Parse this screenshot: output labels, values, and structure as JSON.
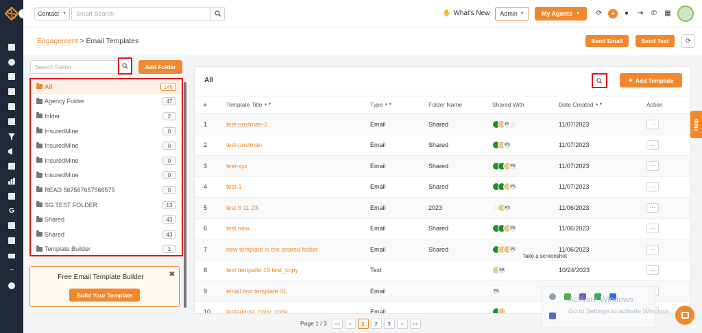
{
  "topbar": {
    "contact_select": "Contact",
    "search_placeholder": "Smart Search",
    "whats_new": "What's New",
    "role": "Admin",
    "my_agents": "My Agents"
  },
  "breadcrumb": {
    "root": "Engagement",
    "separator": ">",
    "current": "Email Templates"
  },
  "actions": {
    "send_email": "Send Email",
    "send_text": "Send Text"
  },
  "folders": {
    "search_placeholder": "Search Folder",
    "add_folder": "Add Folder",
    "items": [
      {
        "name": "All",
        "count": "146",
        "active": true
      },
      {
        "name": "Agency Folder",
        "count": "47"
      },
      {
        "name": "folder",
        "count": "2"
      },
      {
        "name": "InsuredMine",
        "count": "0"
      },
      {
        "name": "InsuredMine",
        "count": "0"
      },
      {
        "name": "InsuredMine",
        "count": "0"
      },
      {
        "name": "InsuredMine",
        "count": "0"
      },
      {
        "name": "READ 567567657566575",
        "count": "0"
      },
      {
        "name": "SG TEST FOLDER",
        "count": "13"
      },
      {
        "name": "Shared",
        "count": "43"
      },
      {
        "name": "Shared",
        "count": "43"
      },
      {
        "name": "Template Builder",
        "count": "1"
      }
    ]
  },
  "promo": {
    "title": "Free Email Template Builder",
    "button": "Build Your Template"
  },
  "templates": {
    "panel_title": "All",
    "add_button": "Add Template",
    "columns": {
      "num": "#",
      "title": "Template Title",
      "type": "Type",
      "folder": "Folder Name",
      "shared": "Shared With",
      "date": "Date Created",
      "action": "Action"
    },
    "rows": [
      {
        "num": "1",
        "title": "test-postman-2",
        "type": "Email",
        "folder": "Shared",
        "shared": [
          "green",
          "face",
          "ps",
          "person"
        ],
        "date": "11/07/2023"
      },
      {
        "num": "2",
        "title": "test-postman",
        "type": "Email",
        "folder": "Shared",
        "shared": [
          "green",
          "face",
          "ps"
        ],
        "date": "11/07/2023"
      },
      {
        "num": "3",
        "title": "test-xyz",
        "type": "Email",
        "folder": "Shared",
        "shared": [
          "green",
          "green",
          "face",
          "ps"
        ],
        "date": "11/07/2023"
      },
      {
        "num": "4",
        "title": "test-1",
        "type": "Email",
        "folder": "Shared",
        "shared": [
          "green",
          "green",
          "face",
          "ps"
        ],
        "date": "11/07/2023"
      },
      {
        "num": "5",
        "title": "test 6 11 23",
        "type": "Email",
        "folder": "2023",
        "shared": [
          "person",
          "face",
          "ps"
        ],
        "date": "11/06/2023"
      },
      {
        "num": "6",
        "title": "test new",
        "type": "Email",
        "folder": "Shared",
        "shared": [
          "green",
          "green",
          "face",
          "ps"
        ],
        "date": "11/06/2023"
      },
      {
        "num": "7",
        "title": "new template in the shared folder",
        "type": "Email",
        "folder": "Shared",
        "shared": [
          "green",
          "face",
          "face",
          "ps"
        ],
        "date": "11/06/2023"
      },
      {
        "num": "8",
        "title": "text tempalte 19 test_copy",
        "type": "Text",
        "folder": "",
        "shared": [
          "face",
          "ka"
        ],
        "date": "10/24/2023"
      },
      {
        "num": "9",
        "title": "email text template 01",
        "type": "Email",
        "folder": "",
        "shared": [
          "ps"
        ],
        "date": ""
      },
      {
        "num": "10",
        "title": "testaugust_copy_copy",
        "type": "Email",
        "folder": "",
        "shared": [
          "green",
          "face"
        ],
        "date": ""
      }
    ],
    "avatar_labels": {
      "ps": "PS",
      "ka": "KA"
    }
  },
  "pagination": {
    "label": "Page 1 / 3",
    "first": "<<",
    "prev": "<",
    "pages": [
      "1",
      "2",
      "3"
    ],
    "next": ">",
    "last": ">>"
  },
  "help": "Help",
  "tooltip": "Take a screenshot",
  "windows": {
    "title": "Activate Windows",
    "subtitle": "Go to Settings to activate Windows."
  },
  "colors": {
    "accent": "#f0892e",
    "sidebar": "#1f2937",
    "highlight_box": "#e0161c"
  }
}
